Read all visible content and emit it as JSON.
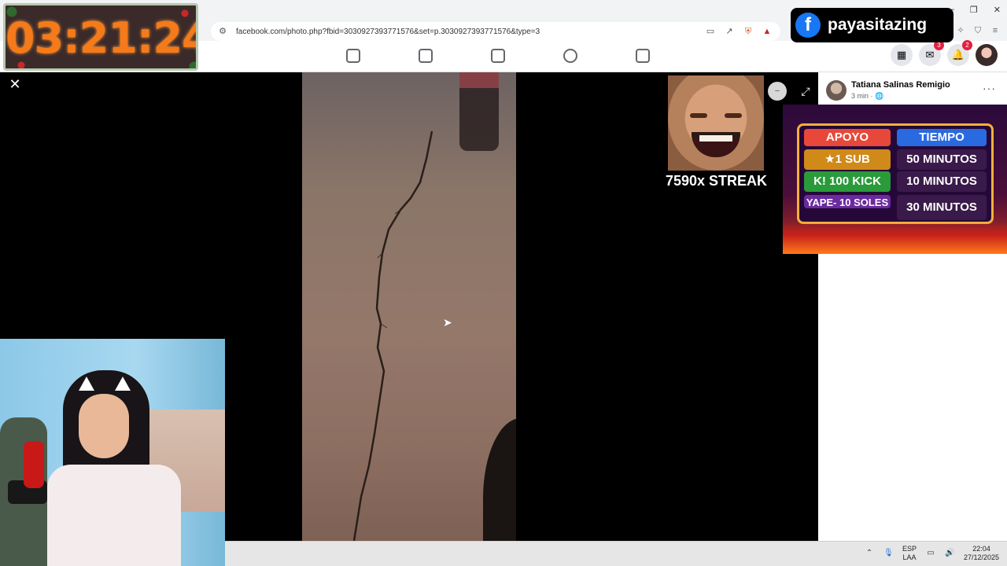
{
  "timer": {
    "text": "03:21:24"
  },
  "brand": {
    "fb_glyph": "f",
    "name": "payasitazing"
  },
  "browser": {
    "url": "facebook.com/photo.php?fbid=3030927393771576&set=p.3030927393771576&type=3",
    "url_icon": "site-settings-icon",
    "window_controls": {
      "minimize": "—",
      "maximize": "❐",
      "close": "✕"
    }
  },
  "fb_nav": {
    "icons": [
      "home-icon",
      "video-icon",
      "marketplace-icon",
      "groups-icon",
      "gaming-icon"
    ],
    "messenger_badge": "3",
    "notifications_badge": "2"
  },
  "viewer": {
    "close_glyph": "✕",
    "expand_glyph": "⤢",
    "zoom_glyph": "−"
  },
  "streak": {
    "text": "7590x STREAK"
  },
  "post": {
    "author": "Tatiana Salinas Remigio",
    "time": "3 min · ",
    "privacy_glyph": "🌐",
    "more_glyph": "···"
  },
  "promo": {
    "head_left": "APOYO",
    "head_right": "TIEMPO",
    "rows": [
      {
        "left": "★1 SUB",
        "right": "50 MINUTOS"
      },
      {
        "left": "K! 100 KICK",
        "right": "10 MINUTOS"
      },
      {
        "left": "YAPE- 10 SOLES",
        "right": "30 MINUTOS"
      }
    ]
  },
  "taskbar": {
    "lang_top": "ESP",
    "lang_bottom": "LAA",
    "time": "22:04",
    "date": "27/12/2025"
  },
  "colors": {
    "fb_blue": "#1877f2",
    "timer_orange": "#f47a1a",
    "badge_red": "#e41e3f"
  }
}
